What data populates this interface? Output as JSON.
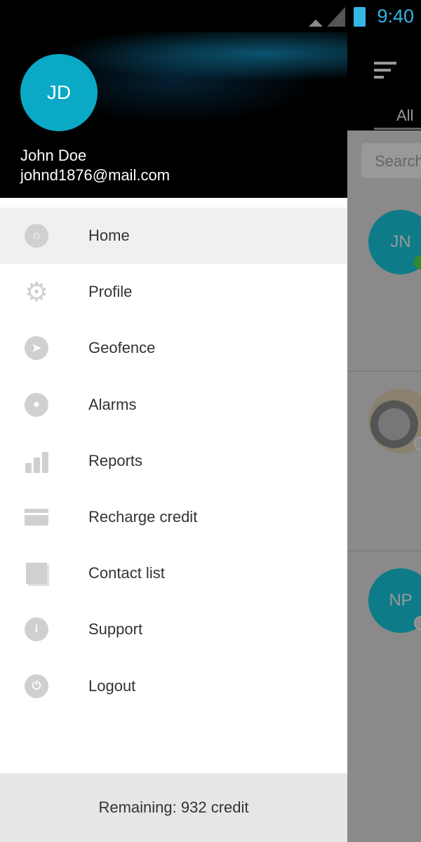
{
  "status_bar": {
    "time": "9:40",
    "icons": [
      "wifi-icon",
      "signal-icon",
      "battery-icon"
    ]
  },
  "background_app": {
    "tab": "All",
    "search_placeholder": "Search",
    "contacts": [
      {
        "initials": "JN",
        "status_color": "#2e8b2e"
      },
      {
        "initials": "",
        "photo": "car"
      },
      {
        "initials": "NP"
      }
    ]
  },
  "drawer": {
    "user": {
      "initials": "JD",
      "name": "John Doe",
      "email": "johnd1876@mail.com"
    },
    "items": [
      {
        "label": "Home",
        "icon": "home-icon",
        "active": true
      },
      {
        "label": "Profile",
        "icon": "gear-icon"
      },
      {
        "label": "Geofence",
        "icon": "navigation-icon"
      },
      {
        "label": "Alarms",
        "icon": "bell-icon"
      },
      {
        "label": "Reports",
        "icon": "bar-chart-icon"
      },
      {
        "label": "Recharge credit",
        "icon": "credit-card-icon"
      },
      {
        "label": "Contact list",
        "icon": "contact-icon"
      },
      {
        "label": "Support",
        "icon": "info-icon"
      },
      {
        "label": "Logout",
        "icon": "power-icon"
      }
    ],
    "footer": "Remaining:  932 credit"
  }
}
